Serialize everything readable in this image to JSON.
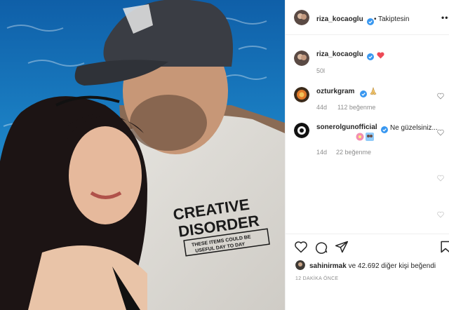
{
  "photo": {
    "description_icon": "photo",
    "shirt_line1": "CREATIVE",
    "shirt_line2": "DISORDER",
    "shirt_tag_line1": "THESE ITEMS COULD BE",
    "shirt_tag_line2": "USEFUL DAY TO DAY"
  },
  "header": {
    "username": "riza_kocaoglu",
    "follow_status": "Takiptesin",
    "dot": "•",
    "more": "•••"
  },
  "caption": {
    "username": "riza_kocaoglu",
    "emoji": "red-heart",
    "time": "50l"
  },
  "comments": [
    {
      "username": "ozturkgram",
      "text": "",
      "emoji": "folded-hands",
      "time": "44d",
      "likes": "112 beğenme"
    },
    {
      "username": "sonerolgunofficial",
      "text": "Ne güzelsiniz...",
      "emoji": "flower-couple",
      "time": "14d",
      "likes": "22 beğenme"
    }
  ],
  "actions": {
    "liked_by_user": "sahinirmak",
    "liked_by_rest": "ve 42.692 diğer kişi beğendi",
    "time_ago": "12 DAKİKA ÖNCE"
  },
  "colors": {
    "verified": "#3897f0",
    "heart": "#ed4956",
    "sea": "#1a73b8",
    "border": "#efefef"
  }
}
